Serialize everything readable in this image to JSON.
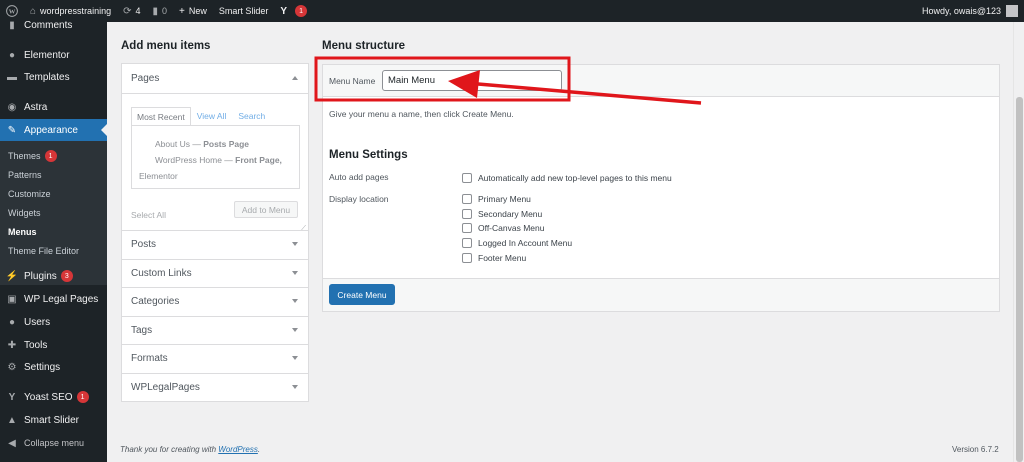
{
  "admin_bar": {
    "site_name": "wordpresstraining",
    "updates_count": "4",
    "comments_count": "0",
    "new_label": "New",
    "smart_slider_label": "Smart Slider",
    "yoast_badge": "1",
    "howdy": "Howdy, owais@123"
  },
  "sidebar": {
    "comments": "Comments",
    "elementor": "Elementor",
    "templates": "Templates",
    "astra": "Astra",
    "appearance": "Appearance",
    "submenu": {
      "themes": "Themes",
      "themes_badge": "1",
      "patterns": "Patterns",
      "customize": "Customize",
      "widgets": "Widgets",
      "menus": "Menus",
      "theme_file_editor": "Theme File Editor"
    },
    "plugins": "Plugins",
    "plugins_badge": "3",
    "wp_legal_pages": "WP Legal Pages",
    "users": "Users",
    "tools": "Tools",
    "settings": "Settings",
    "yoast_seo": "Yoast SEO",
    "yoast_badge": "1",
    "smart_slider": "Smart Slider",
    "collapse": "Collapse menu"
  },
  "add_menu_items": {
    "title": "Add menu items",
    "pages_heading": "Pages",
    "tabs": [
      "Most Recent",
      "View All",
      "Search"
    ],
    "pages": [
      {
        "title": "About Us",
        "sep": " — ",
        "state": "Posts Page"
      },
      {
        "title": "WordPress Home",
        "sep": " — ",
        "state": "Front Page,"
      }
    ],
    "pages_wrap": "Elementor",
    "select_all": "Select All",
    "add_to_menu": "Add to Menu",
    "sections": [
      "Posts",
      "Custom Links",
      "Categories",
      "Tags",
      "Formats",
      "WPLegalPages"
    ]
  },
  "menu_structure": {
    "title": "Menu structure",
    "menu_name_label": "Menu Name",
    "menu_name_value": "Main Menu",
    "hint": "Give your menu a name, then click Create Menu.",
    "settings_title": "Menu Settings",
    "auto_add_label": "Auto add pages",
    "auto_add_option": "Automatically add new top-level pages to this menu",
    "display_location_label": "Display location",
    "locations": [
      "Primary Menu",
      "Secondary Menu",
      "Off-Canvas Menu",
      "Logged In Account Menu",
      "Footer Menu"
    ],
    "create_button": "Create Menu"
  },
  "footer": {
    "thanks_prefix": "Thank you for creating with ",
    "thanks_link": "WordPress",
    "thanks_suffix": ".",
    "version": "Version 6.7.2"
  },
  "colors": {
    "admin_dark": "#1d2327",
    "accent_blue": "#2271b1",
    "annotation_red": "#e0161b"
  },
  "icons": [
    "wordpress-icon",
    "home-icon",
    "updates-icon",
    "comment-icon",
    "plus-icon",
    "yoast-icon",
    "avatar-icon"
  ]
}
